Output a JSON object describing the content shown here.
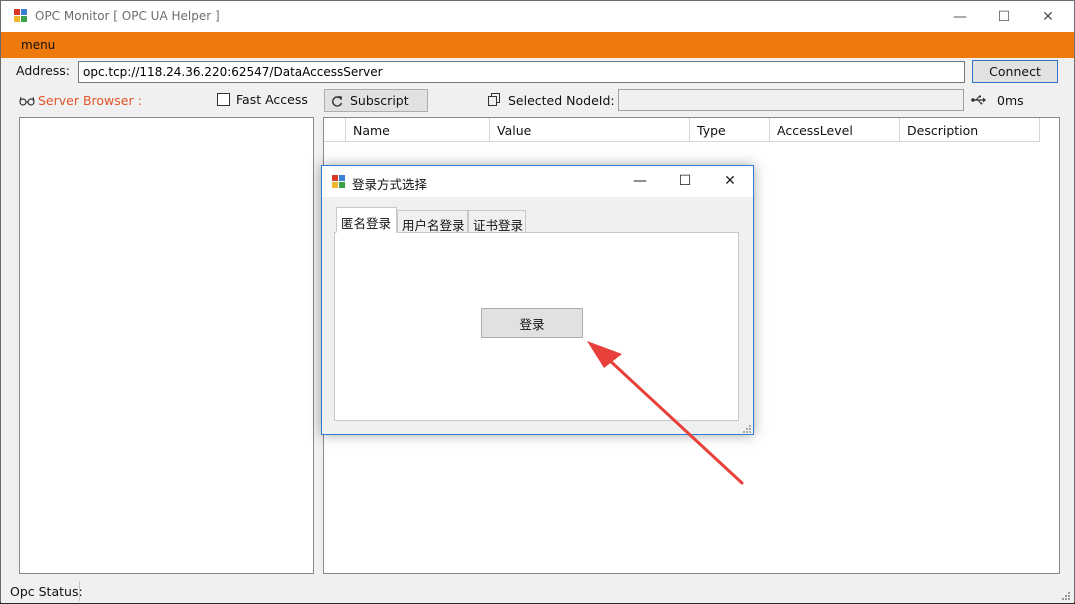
{
  "window": {
    "title": "OPC Monitor [ OPC UA Helper ]",
    "minimize_glyph": "—",
    "maximize_glyph": "☐",
    "close_glyph": "✕"
  },
  "menu": {
    "item": "menu"
  },
  "toolbar": {
    "address_label": "Address:",
    "address_value": "opc.tcp://118.24.36.220:62547/DataAccessServer",
    "connect_label": "Connect",
    "server_browser_label": "Server Browser :",
    "fast_access_label": "Fast Access",
    "subscript_label": "Subscript",
    "selected_nodeid_label": "Selected NodeId:",
    "latency": "0ms"
  },
  "grid": {
    "columns": [
      "Name",
      "Value",
      "Type",
      "AccessLevel",
      "Description"
    ]
  },
  "status": {
    "label": "Opc Status:"
  },
  "dialog": {
    "title": "登录方式选择",
    "tabs": [
      "匿名登录",
      "用户名登录",
      "证书登录"
    ],
    "login_button": "登录"
  },
  "colors": {
    "menubar": "#ee7a0d",
    "server_browser_text": "#e0542a",
    "dialog_border": "#2d7ed3",
    "annotation_arrow": "#e8413b"
  },
  "icons": [
    "app-icon",
    "glasses-icon",
    "refresh-icon",
    "copy-icon",
    "usb-icon",
    "resize-grip-icon"
  ]
}
